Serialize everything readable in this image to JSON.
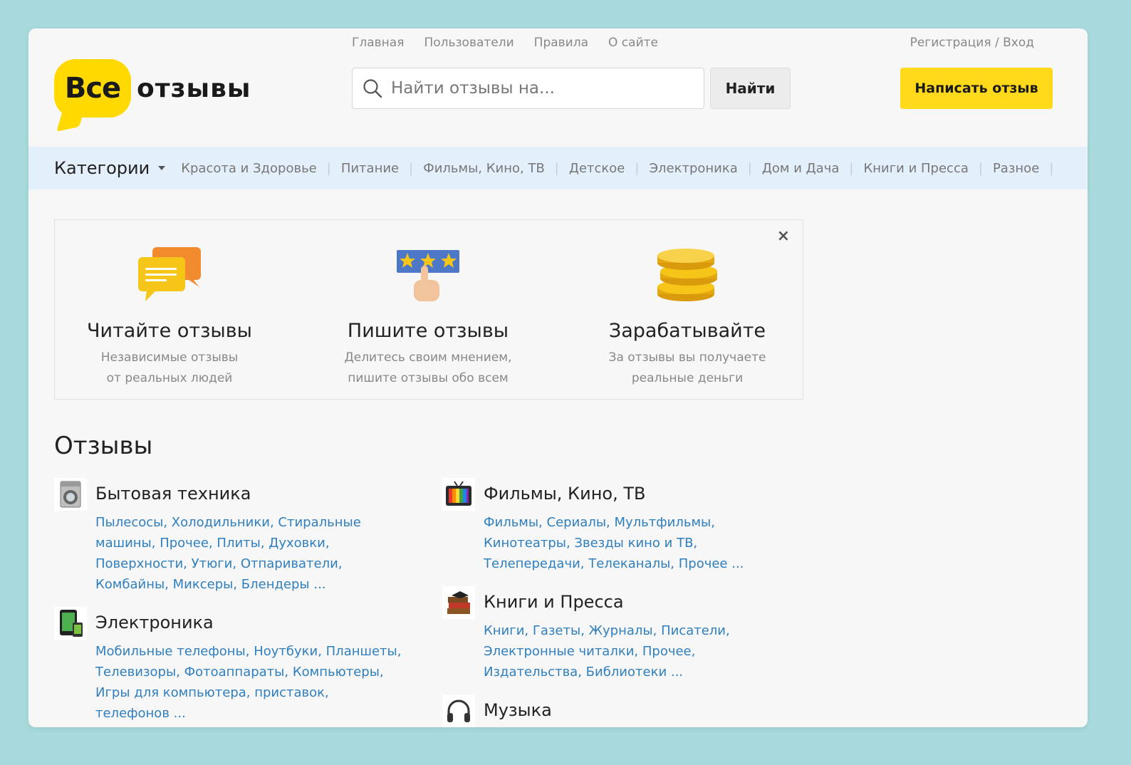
{
  "header": {
    "logo_word1": "Все",
    "logo_word2": "отзывы",
    "nav": [
      "Главная",
      "Пользователи",
      "Правила",
      "О сайте"
    ],
    "auth": "Регистрация / Вход",
    "search_placeholder": "Найти отзывы на...",
    "search_button": "Найти",
    "write_button": "Написать отзыв"
  },
  "categories_bar": {
    "label": "Категории",
    "items": [
      "Красота и Здоровье",
      "Питание",
      "Фильмы, Кино, ТВ",
      "Детское",
      "Электроника",
      "Дом и Дача",
      "Книги и Пресса",
      "Разное"
    ]
  },
  "promo": {
    "close": "×",
    "columns": [
      {
        "title": "Читайте отзывы",
        "line1": "Независимые отзывы",
        "line2": "от реальных людей",
        "icon": "chat-bubbles-icon"
      },
      {
        "title": "Пишите отзывы",
        "line1": "Делитесь своим мнением,",
        "line2": "пишите отзывы обо всем",
        "icon": "rating-stars-icon"
      },
      {
        "title": "Зарабатывайте",
        "line1": "За отзывы вы получаете",
        "line2": "реальные деньги",
        "icon": "coins-icon"
      }
    ]
  },
  "reviews": {
    "title": "Отзывы",
    "blocks": [
      {
        "name": "Бытовая техника",
        "icon": "washing-machine-icon",
        "lines": [
          "Пылесосы, Холодильники, Стиральные",
          "машины, Прочее, Плиты, Духовки,",
          "Поверхности, Утюги, Отпариватели,",
          "Комбайны, Миксеры, Блендеры ..."
        ]
      },
      {
        "name": "Электроника",
        "icon": "phone-tablet-icon",
        "lines": [
          "Мобильные телефоны, Ноутбуки, Планшеты,",
          "Телевизоры, Фотоаппараты, Компьютеры,",
          "Игры для компьютера, приставок,",
          "телефонов ..."
        ]
      },
      {
        "name": "Фильмы, Кино, ТВ",
        "icon": "tv-icon",
        "lines": [
          "Фильмы, Сериалы, Мультфильмы,",
          "Кинотеатры, Звезды кино и ТВ,",
          "Телепередачи, Телеканалы, Прочее ..."
        ]
      },
      {
        "name": "Книги и Пресса",
        "icon": "books-icon",
        "lines": [
          "Книги, Газеты, Журналы, Писатели,",
          "Электронные читалки, Прочее,",
          "Издательства, Библиотеки ..."
        ]
      },
      {
        "name": "Музыка",
        "icon": "headphones-icon",
        "lines": []
      }
    ]
  },
  "colors": {
    "accent": "#ffd91a",
    "link": "#2f7fbf",
    "background": "#a8dadc",
    "catbar": "#e3f0fb"
  }
}
